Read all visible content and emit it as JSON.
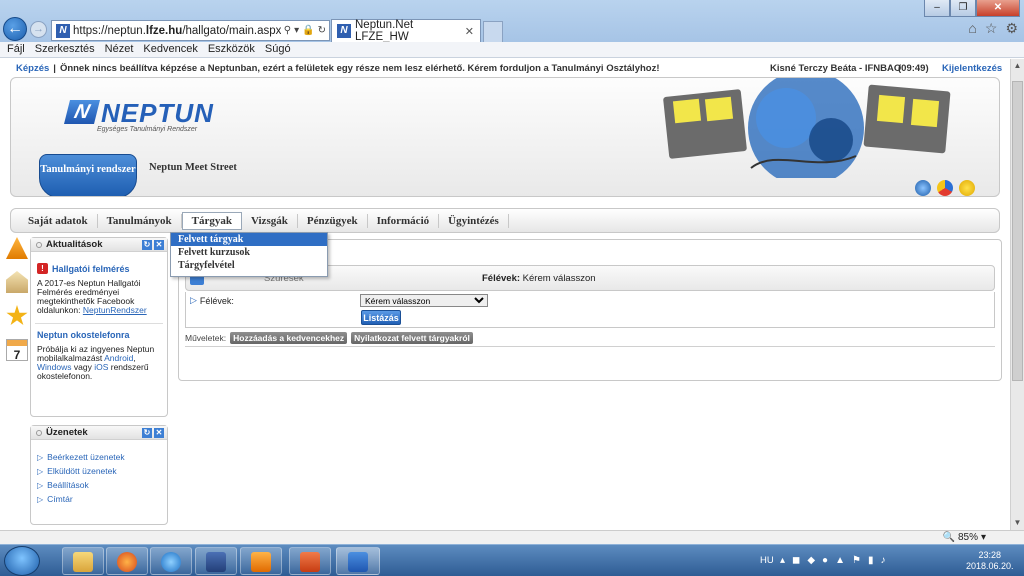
{
  "browser": {
    "address": "https://neptun.lfze.hu/hallgato/main.aspx?ismenu",
    "address_prefix": "https://neptun.",
    "address_domain": "lfze.hu",
    "address_suffix": "/hallgato/main.aspx?ismenu",
    "tab_title": "Neptun.Net LFZE_HW",
    "menu": [
      "Fájl",
      "Szerkesztés",
      "Nézet",
      "Kedvencek",
      "Eszközök",
      "Súgó"
    ],
    "zoom": "85%"
  },
  "notice": {
    "kepzes": "Képzés",
    "separator": "|",
    "message": "Önnek nincs beállítva képzése a Neptunban, ezért a felületek egy része nem lesz elérhető. Kérem forduljon a Tanulmányi Osztályhoz!",
    "user": "Kisné Terczy Beáta - IFNBAO",
    "timer": "(09:49)",
    "logout": "Kijelentkezés"
  },
  "header": {
    "logo_text": "NEPTUN",
    "logo_sub": "Egységes Tanulmányi Rendszer",
    "system_tab": "Tanulmányi rendszer",
    "meet_street": "Neptun Meet Street"
  },
  "nav": {
    "items": [
      "Saját adatok",
      "Tanulmányok",
      "Tárgyak",
      "Vizsgák",
      "Pénzügyek",
      "Információ",
      "Ügyintézés"
    ],
    "active": "Tárgyak",
    "dropdown": [
      "Felvett tárgyak",
      "Felvett kurzusok",
      "Tárgyfelvétel"
    ]
  },
  "news_panel": {
    "title": "Aktualitások",
    "item1_title": "Hallgatói felmérés",
    "item1_text": "A 2017-es Neptun Hallgatói Felmérés eredményei megtekinthetők Facebook oldalunkon:",
    "item1_link": "NeptunRendszer",
    "item2_title": "Neptun okostelefonra",
    "item2_text_a": "Próbálja ki az ingyenes Neptun mobilalkalmazást",
    "item2_android": "Android",
    "item2_windows": "Windows",
    "item2_vagy": "vagy",
    "item2_ios": "iOS",
    "item2_text_b": "rendszerű okostelefonon."
  },
  "messages_panel": {
    "title": "Üzenetek",
    "items": [
      "Beérkezett üzenetek",
      "Elküldött üzenetek",
      "Beállítások",
      "Címtár"
    ]
  },
  "main": {
    "row_left": "Szűrések",
    "row_right_label": "Félévek:",
    "row_right_value": "Kérem válasszon",
    "filter_label": "Félévek:",
    "select_value": "Kérem válasszon",
    "list_button": "Listázás",
    "actions_label": "Műveletek:",
    "action1": "Hozzáadás a kedvencekhez",
    "action2": "Nyilatkozat felvett tárgyakról"
  },
  "taskbar": {
    "lang": "HU",
    "time": "23:28",
    "date": "2018.06.20."
  }
}
